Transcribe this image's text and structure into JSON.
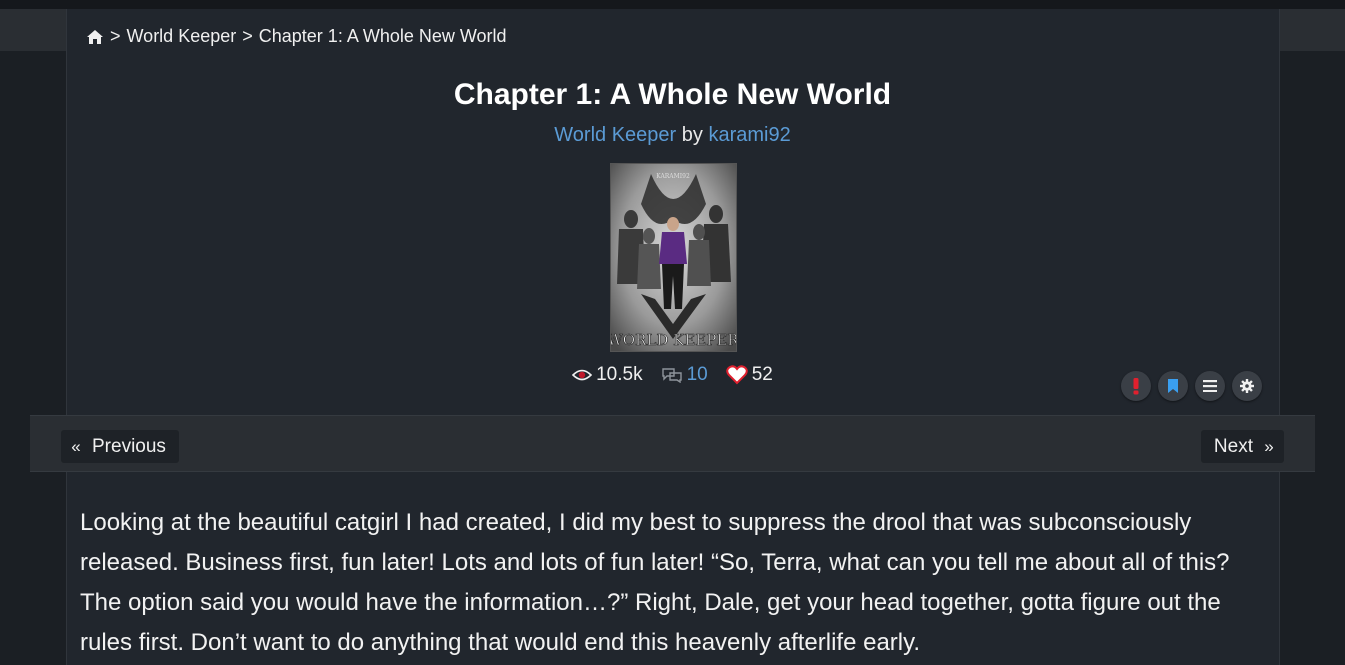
{
  "breadcrumb": {
    "separator": ">",
    "items": [
      "World Keeper",
      "Chapter 1: A Whole New World"
    ]
  },
  "chapter": {
    "title": "Chapter 1: A Whole New World",
    "story_title": "World Keeper",
    "by": "by",
    "author": "karami92"
  },
  "cover": {
    "title_text": "WORLD KEEPER",
    "author_text": "KARAMI92"
  },
  "stats": {
    "views": "10.5k",
    "comments": "10",
    "likes": "52"
  },
  "tools": [
    "report-icon",
    "bookmark-icon",
    "menu-icon",
    "settings-icon"
  ],
  "nav": {
    "prev_arrow": "«",
    "prev_label": "Previous",
    "next_label": "Next",
    "next_arrow": "»"
  },
  "content": {
    "paragraph": "Looking at the beautiful catgirl I had created, I did my best to suppress the drool that was subconsciously released. Business first, fun later! Lots and lots of fun later! “So, Terra, what can you tell me about all of this? The option said you would have the information…?” Right, Dale, get your head together, gotta figure out the rules first. Don’t want to do anything that would end this heavenly afterlife early."
  },
  "colors": {
    "background": "#1b1f24",
    "panel": "#21262d",
    "link": "#5b9bd5",
    "heart": "#e0202e"
  }
}
